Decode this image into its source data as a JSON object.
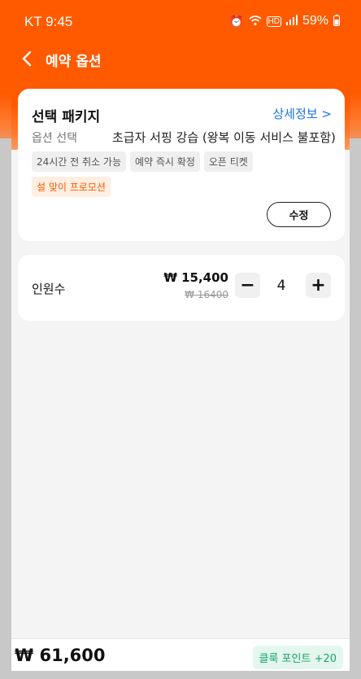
{
  "status": {
    "carrier_time": "KT 9:45",
    "icons": [
      "alarm-icon",
      "wifi-icon",
      "hd-icon",
      "signal-icon"
    ],
    "battery": "59%"
  },
  "appbar": {
    "title": "예약 옵션",
    "back_icon": "chevron-left-icon"
  },
  "package": {
    "title": "선택 패키지",
    "detail_link": "상세정보 >",
    "option_label": "옵션 선택",
    "option_value": "초급자 서핑 강습 (왕복 이동 서비스 불포함)",
    "tags": [
      "24시간 전 취소 가능",
      "예약 즉시 확정",
      "오픈 티켓"
    ],
    "promo": "설 맞이 프로모션",
    "edit_button": "수정"
  },
  "participants": {
    "label": "인원수",
    "price": "₩ 15,400",
    "original_price": "₩ 16400",
    "quantity": "4",
    "minus_label": "−",
    "plus_label": "+"
  },
  "footer": {
    "total": "₩ 61,600",
    "points": "클룩 포인트 +20"
  },
  "colors": {
    "accent": "#ff5a00",
    "link": "#1a73e8",
    "points": "#19a36b"
  }
}
